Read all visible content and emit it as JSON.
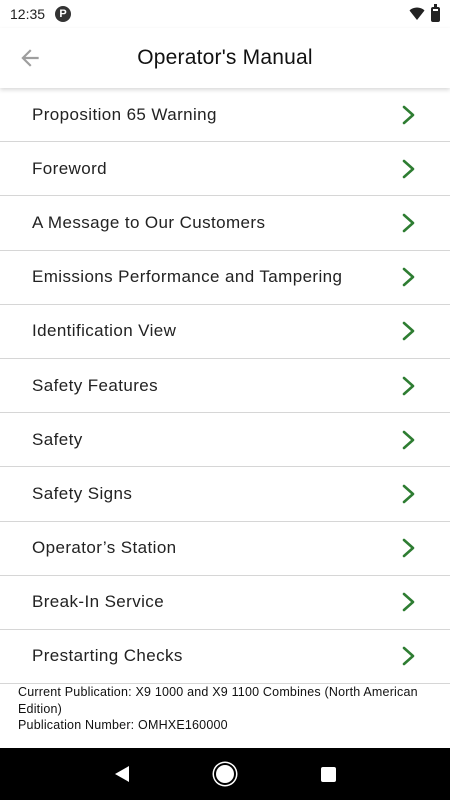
{
  "status": {
    "time": "12:35",
    "app_icon_glyph": "P"
  },
  "header": {
    "title": "Operator's Manual",
    "back_icon": "arrow-left-icon"
  },
  "menu": {
    "items": [
      {
        "label": "Proposition 65 Warning"
      },
      {
        "label": "Foreword"
      },
      {
        "label": "A Message to Our Customers"
      },
      {
        "label": "Emissions Performance and Tampering"
      },
      {
        "label": "Identification View"
      },
      {
        "label": "Safety Features"
      },
      {
        "label": "Safety"
      },
      {
        "label": "Safety Signs"
      },
      {
        "label": "Operator’s Station"
      },
      {
        "label": "Break-In Service"
      },
      {
        "label": "Prestarting Checks"
      }
    ],
    "chevron_color": "#2e7d32"
  },
  "publication": {
    "current": "Current Publication: X9 1000 and X9 1100 Combines (North American Edition)",
    "number": "Publication Number: OMHXE160000"
  }
}
